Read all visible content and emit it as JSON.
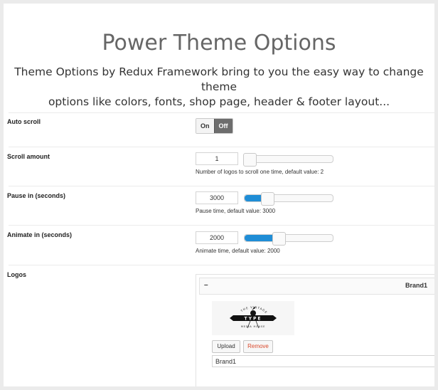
{
  "header": {
    "title": "Power Theme Options",
    "subtitle_line1": "Theme Options by Redux Framework bring to you the easy way to change theme",
    "subtitle_line2": "options like colors, fonts, shop page, header & footer layout..."
  },
  "auto_scroll": {
    "label": "Auto scroll",
    "on_label": "On",
    "off_label": "Off",
    "selected": "Off"
  },
  "scroll_amount": {
    "label": "Scroll amount",
    "value": "1",
    "level": 0,
    "description": "Number of logos to scroll one time, default value: 2"
  },
  "pause_in": {
    "label": "Pause in (seconds)",
    "value": "3000",
    "level": 0.2,
    "description": "Pause time, default value: 3000"
  },
  "animate_in": {
    "label": "Animate in (seconds)",
    "value": "2000",
    "level": 0.33,
    "description": "Animate time, default value: 2000"
  },
  "logos": {
    "label": "Logos",
    "collapse_symbol": "–",
    "item_title": "Brand1",
    "upload_label": "Upload",
    "remove_label": "Remove",
    "name_value": "Brand1",
    "logo_text_top": "THE VINTAGE",
    "logo_text_mid": "TYPE",
    "logo_text_bottom": "MEDIA HOUSE"
  },
  "colors": {
    "accent": "#1f8dd6",
    "remove_text": "#d9482b",
    "toggle_off_bg": "#6d6d6d"
  }
}
